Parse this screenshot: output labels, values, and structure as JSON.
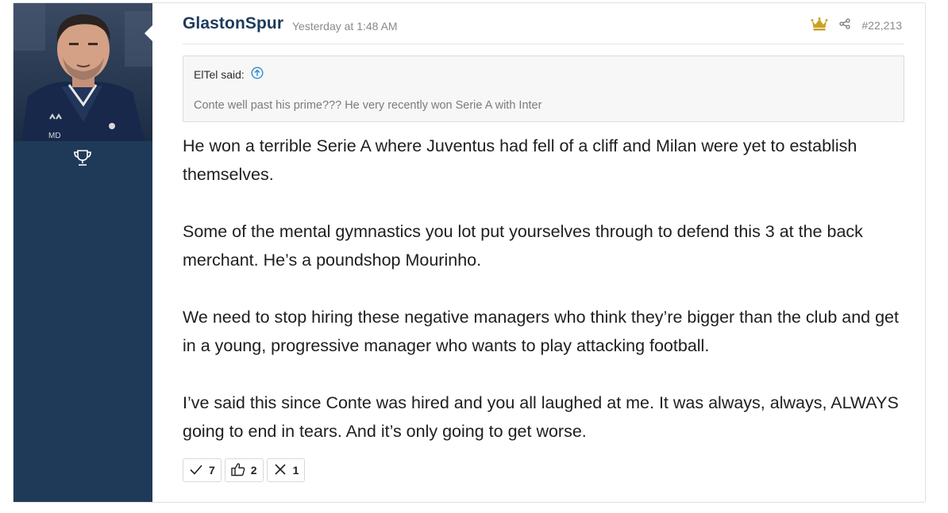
{
  "post": {
    "username": "GlastonSpur",
    "timestamp": "Yesterday at 1:48 AM",
    "post_number": "#22,213",
    "icons": {
      "crown": "crown-icon",
      "share": "share-icon",
      "trophy": "trophy-icon"
    },
    "accent_color": "#1d3a5c",
    "sidebar_color": "#1f3a58",
    "crown_color": "#c9a227"
  },
  "quote": {
    "author": "ElTel said:",
    "text": "Conte well past his prime??? He very recently won Serie A with Inter"
  },
  "message": {
    "paragraphs": [
      "He won a terrible Serie A where Juventus had fell of a cliff and Milan were yet to establish themselves.",
      "Some of the mental gymnastics you lot put yourselves through to defend this 3 at the back merchant. He’s a poundshop Mourinho.",
      "We need to stop hiring these negative managers who think they’re bigger than the club and get in a young, progressive manager who wants to play attacking football.",
      "I’ve said this since Conte was hired and you all laughed at me. It was always, always, ALWAYS going to end in tears. And it’s only going to get worse."
    ]
  },
  "reactions": [
    {
      "icon": "check-icon",
      "count": "7"
    },
    {
      "icon": "thumbs-up-icon",
      "count": "2"
    },
    {
      "icon": "x-icon",
      "count": "1"
    }
  ]
}
